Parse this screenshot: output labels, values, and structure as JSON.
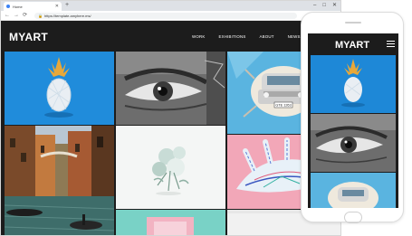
{
  "browser": {
    "tab_title": "Home",
    "url": "https://template.amyhere.ms/",
    "new_tab": "+"
  },
  "site": {
    "logo": "MYART",
    "nav": [
      "WORK",
      "EXHIBITIONS",
      "ABOUT",
      "NEWS"
    ]
  },
  "gallery": {
    "tiles": [
      "pineapple-blue",
      "eye-graffiti",
      "car-wall-mural",
      "venice-canal",
      "white-flowers",
      "hand-painting",
      "pink-frame",
      "light-tile"
    ],
    "car_plate": "GTE 1263"
  },
  "phone": {
    "logo": "MYART"
  },
  "colors": {
    "header_bg": "#1c1c1c",
    "accent_blue": "#1e88d7",
    "pink": "#f2a7b8"
  }
}
